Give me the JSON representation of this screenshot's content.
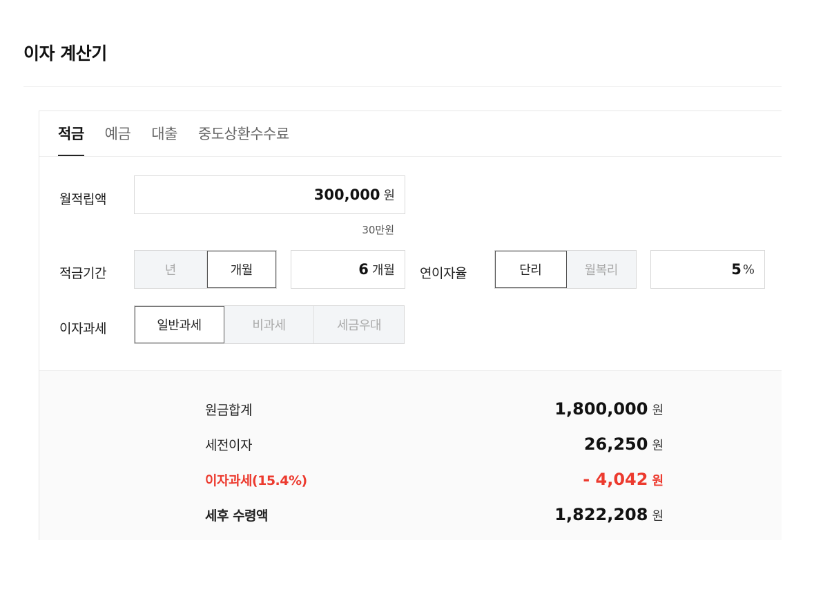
{
  "page": {
    "title": "이자 계산기"
  },
  "tabs": [
    {
      "label": "적금",
      "active": true
    },
    {
      "label": "예금",
      "active": false
    },
    {
      "label": "대출",
      "active": false
    },
    {
      "label": "중도상환수수료",
      "active": false
    }
  ],
  "monthly": {
    "label": "월적립액",
    "value": "300,000",
    "unit": "원",
    "hint": "30만원"
  },
  "period": {
    "label": "적금기간",
    "options": [
      {
        "label": "년",
        "selected": false
      },
      {
        "label": "개월",
        "selected": true
      }
    ],
    "value": "6",
    "unit": "개월"
  },
  "rate": {
    "label": "연이자율",
    "options": [
      {
        "label": "단리",
        "selected": true
      },
      {
        "label": "월복리",
        "selected": false
      }
    ],
    "value": "5",
    "unit": "%"
  },
  "taxation": {
    "label": "이자과세",
    "options": [
      {
        "label": "일반과세",
        "selected": true
      },
      {
        "label": "비과세",
        "selected": false
      },
      {
        "label": "세금우대",
        "selected": false
      }
    ]
  },
  "results": {
    "principal": {
      "label": "원금합계",
      "value": "1,800,000",
      "unit": "원"
    },
    "pretax": {
      "label": "세전이자",
      "value": "26,250",
      "unit": "원"
    },
    "tax": {
      "label": "이자과세(15.4%)",
      "value": "- 4,042",
      "unit": "원"
    },
    "net": {
      "label": "세후 수령액",
      "value": "1,822,208",
      "unit": "원"
    }
  },
  "colors": {
    "accent_red": "#ec3a2e",
    "border": "#d8d8d8",
    "result_bg": "#fafafa"
  }
}
